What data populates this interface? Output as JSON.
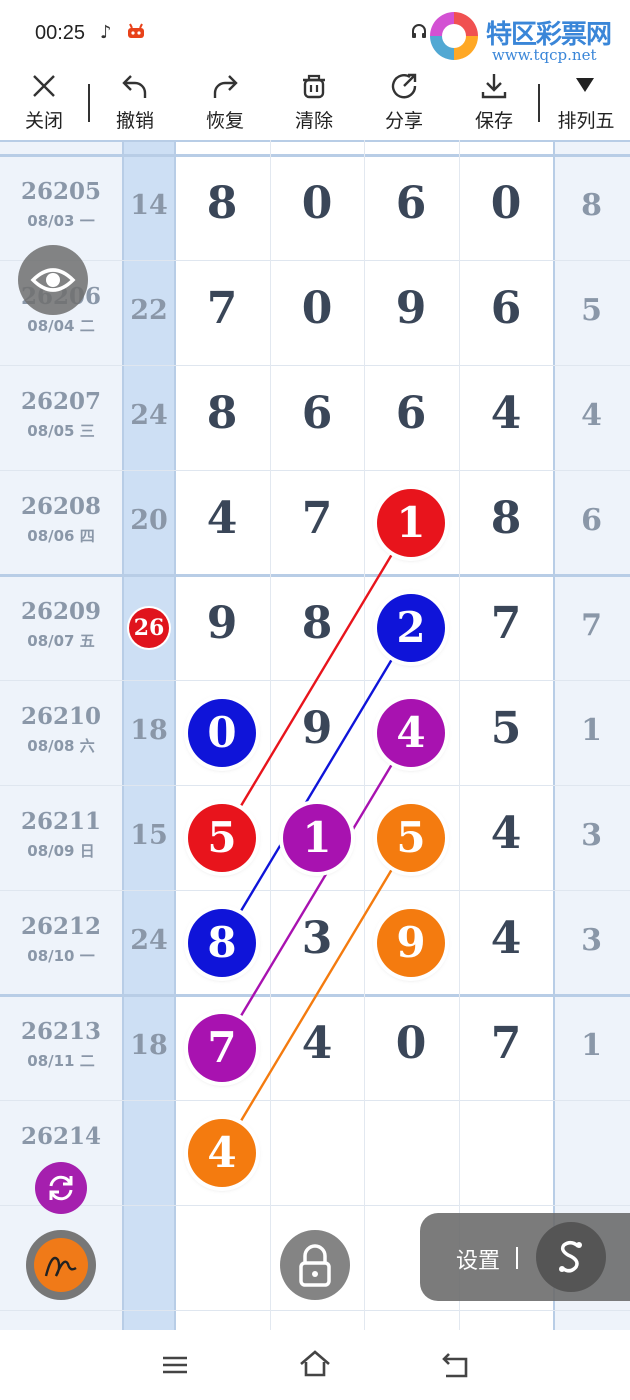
{
  "status_bar": {
    "time": "00:25",
    "icons": [
      "tiktok-icon",
      "notification-icon",
      "headset-icon",
      "signal-icon",
      "battery-icon"
    ]
  },
  "watermark": {
    "title": "特区彩票网",
    "url": "www.tqcp.net"
  },
  "toolbar": {
    "close_label": "关闭",
    "undo_label": "撤销",
    "redo_label": "恢复",
    "clear_label": "清除",
    "share_label": "分享",
    "save_label": "保存",
    "lottery_label": "排列五"
  },
  "rows": [
    {
      "period": "26205",
      "date": "08/03 一",
      "sum": "14",
      "digits": [
        "8",
        "0",
        "6",
        "0"
      ],
      "span": "8"
    },
    {
      "period": "26206",
      "date": "08/04 二",
      "sum": "22",
      "digits": [
        "7",
        "0",
        "9",
        "6"
      ],
      "span": "5"
    },
    {
      "period": "26207",
      "date": "08/05 三",
      "sum": "24",
      "digits": [
        "8",
        "6",
        "6",
        "4"
      ],
      "span": "4"
    },
    {
      "period": "26208",
      "date": "08/06 四",
      "sum": "20",
      "digits": [
        "4",
        "7",
        "1",
        "8"
      ],
      "span": "6"
    },
    {
      "period": "26209",
      "date": "08/07 五",
      "sum": "26",
      "digits": [
        "9",
        "8",
        "2",
        "7"
      ],
      "span": "7"
    },
    {
      "period": "26210",
      "date": "08/08 六",
      "sum": "18",
      "digits": [
        "0",
        "9",
        "4",
        "5"
      ],
      "span": "1"
    },
    {
      "period": "26211",
      "date": "08/09 日",
      "sum": "15",
      "digits": [
        "5",
        "1",
        "5",
        "4"
      ],
      "span": "3"
    },
    {
      "period": "26212",
      "date": "08/10 一",
      "sum": "24",
      "digits": [
        "8",
        "3",
        "9",
        "4"
      ],
      "span": "3"
    },
    {
      "period": "26213",
      "date": "08/11 二",
      "sum": "18",
      "digits": [
        "7",
        "4",
        "0",
        "7"
      ],
      "span": "1"
    },
    {
      "period": "26214",
      "date": "",
      "sum": "",
      "digits": [
        "4",
        "",
        "",
        ""
      ],
      "span": ""
    }
  ],
  "highlighted_sum_row": 4,
  "balls": [
    {
      "row": 3,
      "col": 2,
      "color": "#e8141c"
    },
    {
      "row": 4,
      "col": 2,
      "color": "#0f14d9"
    },
    {
      "row": 5,
      "col": 0,
      "color": "#0f14d9"
    },
    {
      "row": 5,
      "col": 2,
      "color": "#a812b0"
    },
    {
      "row": 6,
      "col": 0,
      "color": "#e8141c"
    },
    {
      "row": 6,
      "col": 1,
      "color": "#a812b0"
    },
    {
      "row": 6,
      "col": 2,
      "color": "#f47b0f"
    },
    {
      "row": 7,
      "col": 0,
      "color": "#0f14d9"
    },
    {
      "row": 7,
      "col": 2,
      "color": "#f47b0f"
    },
    {
      "row": 8,
      "col": 0,
      "color": "#a812b0"
    },
    {
      "row": 9,
      "col": 0,
      "color": "#f47b0f"
    }
  ],
  "trend_lines": [
    {
      "from": [
        3,
        2
      ],
      "to": [
        6,
        0
      ],
      "color": "#e8141c"
    },
    {
      "from": [
        4,
        2
      ],
      "to": [
        7,
        0
      ],
      "color": "#0f14d9"
    },
    {
      "from": [
        5,
        2
      ],
      "to": [
        8,
        0
      ],
      "color": "#a812b0"
    },
    {
      "from": [
        6,
        2
      ],
      "to": [
        9,
        0
      ],
      "color": "#f47b0f"
    }
  ],
  "floating": {
    "settings_label": "设置"
  },
  "nav_icons": [
    "menu-icon",
    "home-icon",
    "back-icon"
  ]
}
